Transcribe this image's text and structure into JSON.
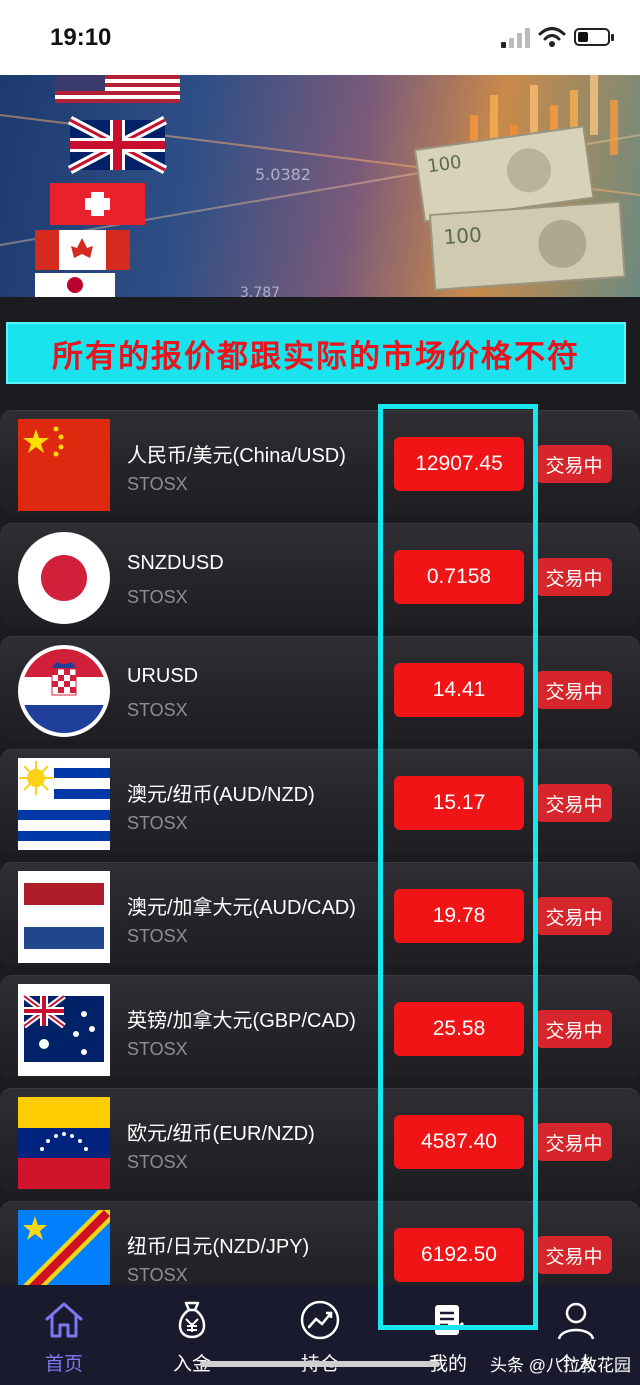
{
  "status_bar": {
    "time": "19:10"
  },
  "notice": {
    "text": "所有的报价都跟实际的市场价格不符"
  },
  "quotes": [
    {
      "name": "人民币/美元(China/USD)",
      "sub": "STOSX",
      "price": "12907.45",
      "status": "交易中",
      "flag": "china-flag"
    },
    {
      "name": "SNZDUSD",
      "sub": "STOSX",
      "price": "0.7158",
      "status": "交易中",
      "flag": "japan-flag"
    },
    {
      "name": "URUSD",
      "sub": "STOSX",
      "price": "14.41",
      "status": "交易中",
      "flag": "croatia-flag"
    },
    {
      "name": "澳元/纽币(AUD/NZD)",
      "sub": "STOSX",
      "price": "15.17",
      "status": "交易中",
      "flag": "uruguay-flag"
    },
    {
      "name": "澳元/加拿大元(AUD/CAD)",
      "sub": "STOSX",
      "price": "19.78",
      "status": "交易中",
      "flag": "netherlands-flag"
    },
    {
      "name": "英镑/加拿大元(GBP/CAD)",
      "sub": "STOSX",
      "price": "25.58",
      "status": "交易中",
      "flag": "australia-flag"
    },
    {
      "name": "欧元/纽币(EUR/NZD)",
      "sub": "STOSX",
      "price": "4587.40",
      "status": "交易中",
      "flag": "venezuela-flag"
    },
    {
      "name": "纽币/日元(NZD/JPY)",
      "sub": "STOSX",
      "price": "6192.50",
      "status": "交易中",
      "flag": "dr-congo-flag"
    }
  ],
  "tabs": [
    {
      "label": "首页",
      "icon": "home-icon",
      "active": true
    },
    {
      "label": "入金",
      "icon": "money-bag-icon"
    },
    {
      "label": "持仓",
      "icon": "chart-circle-icon"
    },
    {
      "label": "我的",
      "icon": "document-edit-icon"
    },
    {
      "label": "个人",
      "icon": "user-icon"
    }
  ],
  "watermark": "头条 @八拉教花园",
  "colors": {
    "price_bg": "#f01416",
    "highlight": "#18e6ee",
    "active_tab": "#7b78f0",
    "notice_bg": "#19e3ec"
  }
}
